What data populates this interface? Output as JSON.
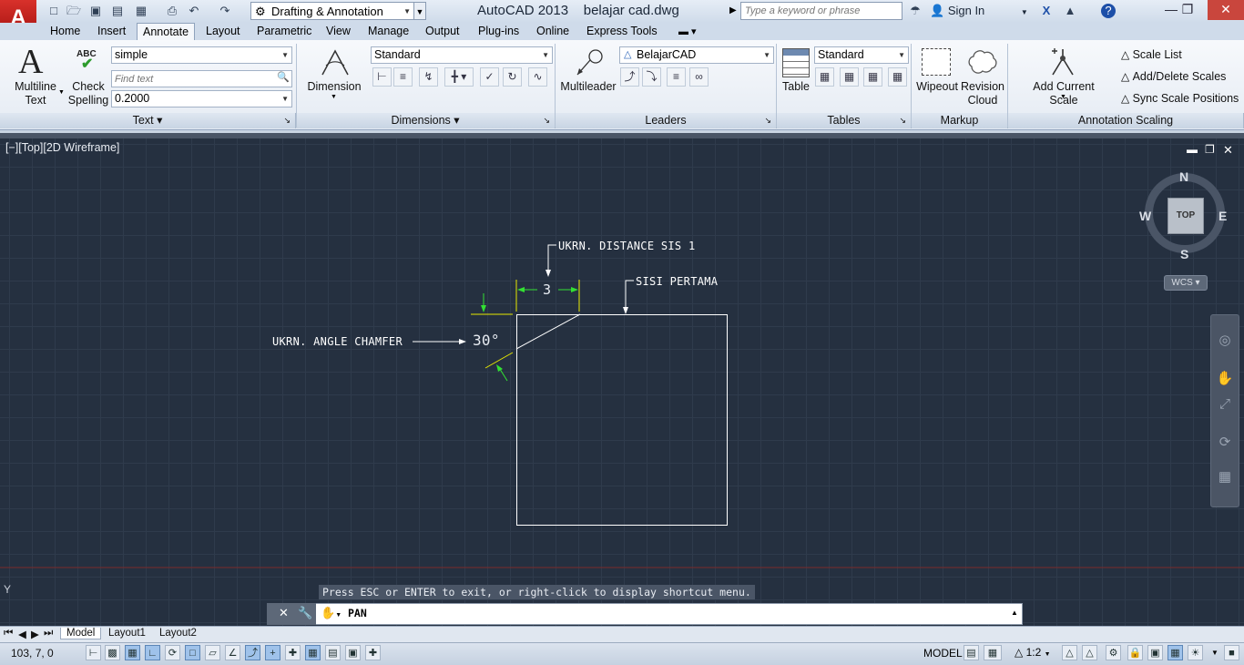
{
  "title_bar": {
    "app_logo": "A",
    "workspace": "Drafting & Annotation",
    "app_name": "AutoCAD 2013",
    "file_name": "belajar cad.dwg",
    "search_placeholder": "Type a keyword or phrase",
    "sign_in": "Sign In",
    "help": "?"
  },
  "ribbon_tabs": [
    "Home",
    "Insert",
    "Annotate",
    "Layout",
    "Parametric",
    "View",
    "Manage",
    "Output",
    "Plug-ins",
    "Online",
    "Express Tools"
  ],
  "active_tab": "Annotate",
  "ribbon": {
    "text_panel": {
      "multiline_text": "Multiline Text",
      "check_spelling": "Check Spelling",
      "abc_glyph": "ABC",
      "text_style": "simple",
      "find_placeholder": "Find text",
      "text_height": "0.2000",
      "footer": "Text"
    },
    "dimensions_panel": {
      "dimension": "Dimension",
      "dim_style": "Standard",
      "footer": "Dimensions"
    },
    "leaders_panel": {
      "multileader": "Multileader",
      "leader_style": "BelajarCAD",
      "footer": "Leaders"
    },
    "tables_panel": {
      "table": "Table",
      "table_style": "Standard",
      "footer": "Tables"
    },
    "markup_panel": {
      "wipeout": "Wipeout",
      "revision_cloud": "Revision Cloud",
      "footer": "Markup"
    },
    "annotation_scaling_panel": {
      "add_current_scale": "Add Current Scale",
      "scale_list": "Scale List",
      "add_delete_scales": "Add/Delete Scales",
      "sync_scale_positions": "Sync Scale Positions",
      "footer": "Annotation Scaling"
    }
  },
  "viewport": {
    "label": "[−][Top][2D Wireframe]",
    "nav_cube": {
      "n": "N",
      "s": "S",
      "e": "E",
      "w": "W",
      "face": "TOP",
      "ucs": "WCS"
    },
    "ucs_y": "Y"
  },
  "drawing": {
    "label_distance": "UKRN. DISTANCE SIS 1",
    "label_side": "SISI PERTAMA",
    "label_angle": "UKRN. ANGLE CHAMFER",
    "dim_value": "3",
    "angle_value": "30°"
  },
  "command": {
    "message": "Press ESC or ENTER to exit, or right-click to display shortcut menu.",
    "input": "PAN"
  },
  "layout_tabs": [
    "Model",
    "Layout1",
    "Layout2"
  ],
  "status_bar": {
    "coords": "103, 7, 0",
    "model": "MODEL",
    "anno_scale": "1:2"
  },
  "colors": {
    "canvas_bg": "#253040",
    "accent_green": "#33e033",
    "accent_yellow": "#e8e800"
  }
}
